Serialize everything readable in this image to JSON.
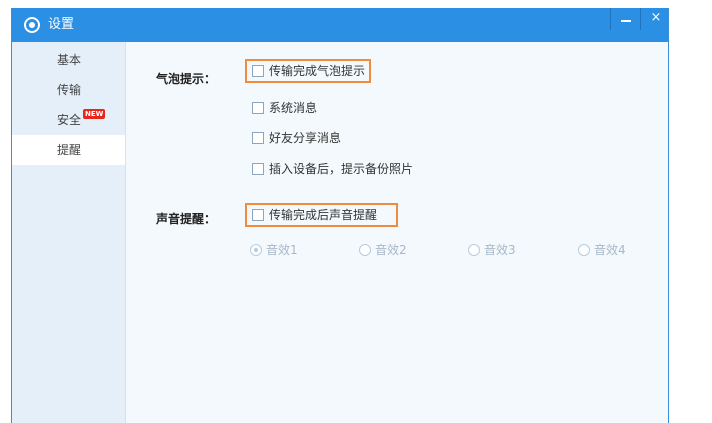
{
  "window": {
    "title": "设置",
    "minimize_glyph": "",
    "close_glyph": "×"
  },
  "sidebar": {
    "items": [
      {
        "label": "基本"
      },
      {
        "label": "传输"
      },
      {
        "label": "安全",
        "badge": "NEW"
      },
      {
        "label": "提醒",
        "active": true
      }
    ]
  },
  "bubble": {
    "label": "气泡提示：",
    "options": [
      {
        "label": "传输完成气泡提示",
        "checked": false
      },
      {
        "label": "系统消息",
        "checked": false
      },
      {
        "label": "好友分享消息",
        "checked": false
      },
      {
        "label": "插入设备后，提示备份照片",
        "checked": false
      }
    ]
  },
  "sound": {
    "label": "声音提醒：",
    "option": {
      "label": "传输完成后声音提醒",
      "checked": false
    },
    "effects": [
      {
        "label": "音效1",
        "selected": true
      },
      {
        "label": "音效2",
        "selected": false
      },
      {
        "label": "音效3",
        "selected": false
      },
      {
        "label": "音效4",
        "selected": false
      }
    ]
  },
  "colors": {
    "titlebar": "#2b8fe3",
    "highlight": "#f08c3c",
    "badge": "#e8261c"
  }
}
